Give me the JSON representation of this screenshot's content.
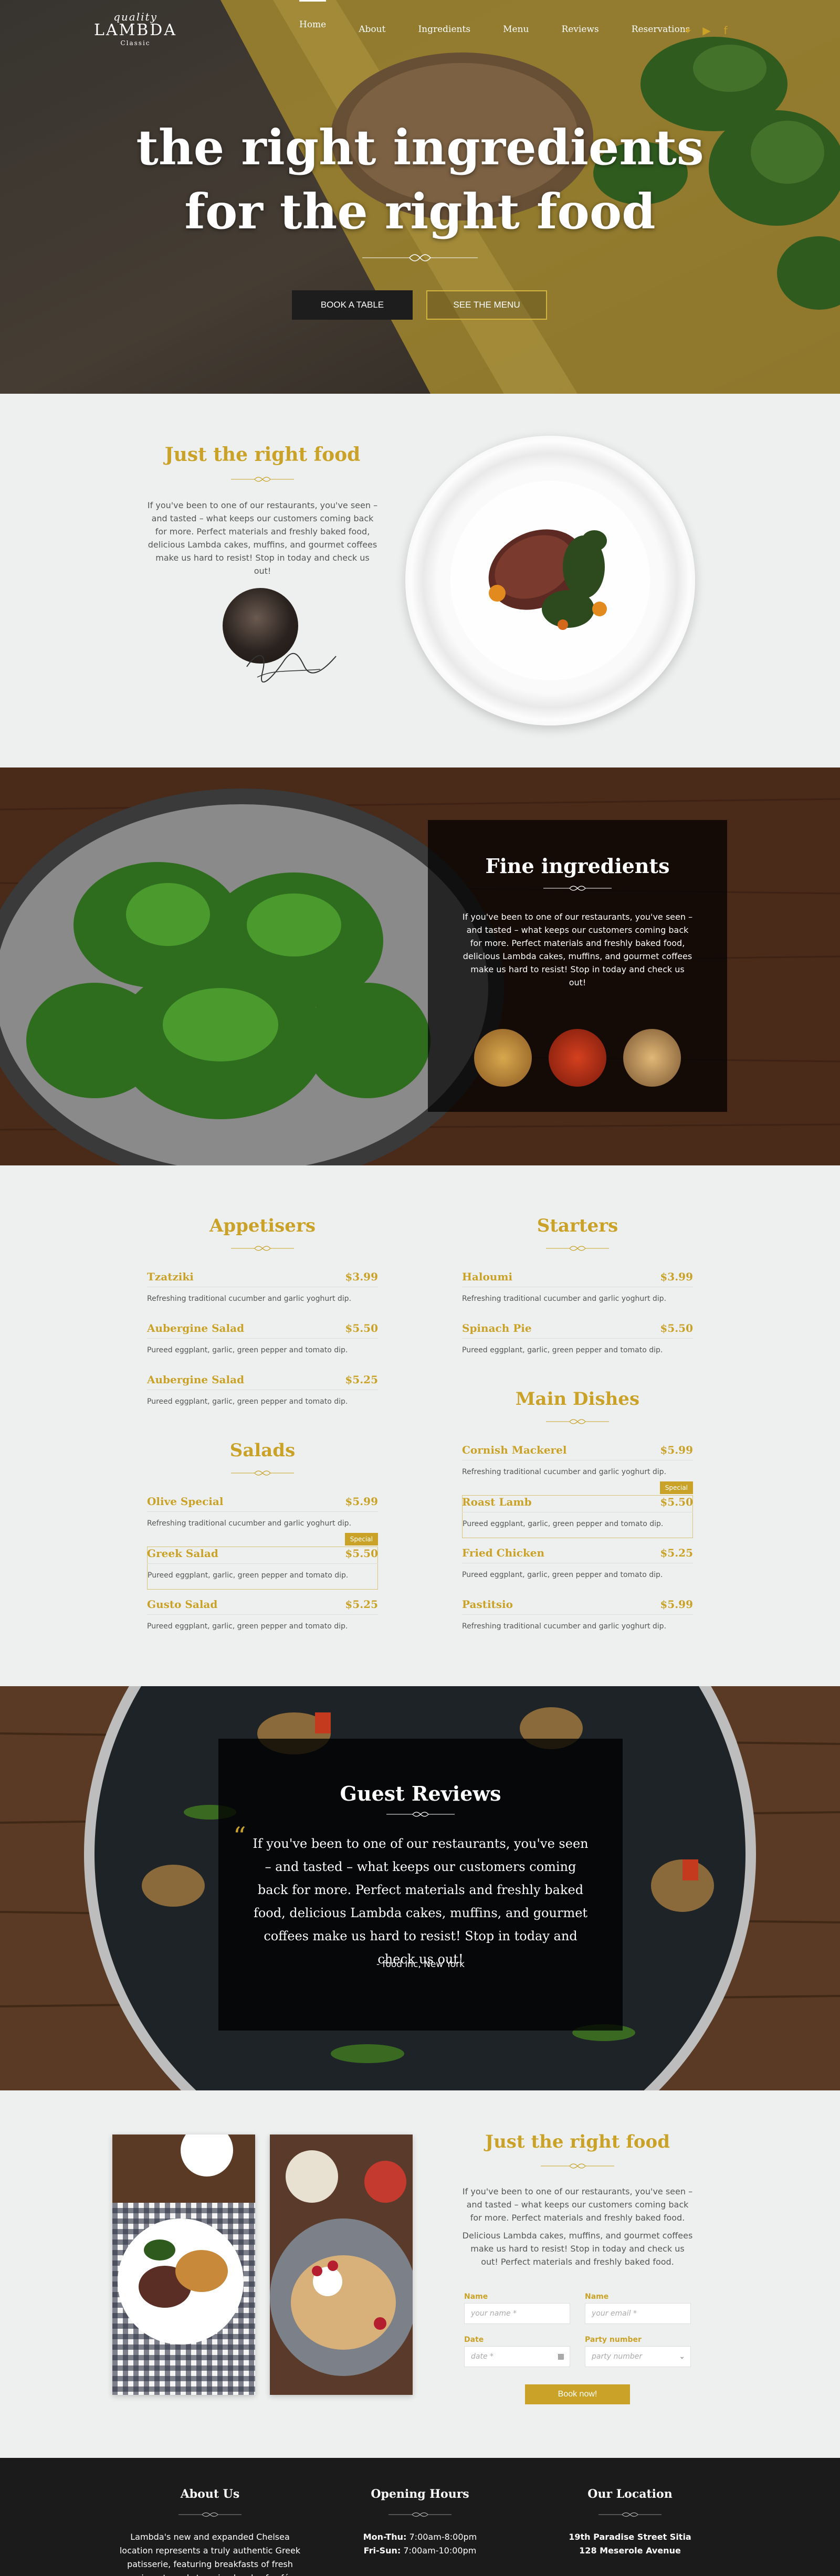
{
  "brand": {
    "top": "quality",
    "name": "LAMBDA",
    "tag": "Classic"
  },
  "nav": [
    "Home",
    "About",
    "Ingredients",
    "Menu",
    "Reviews",
    "Reservations"
  ],
  "social": [
    "twitter-icon",
    "youtube-icon",
    "facebook-icon"
  ],
  "hero": {
    "line1": "the right ingredients",
    "line2": "for the right food",
    "book_btn": "BOOK A TABLE",
    "menu_btn": "SEE THE MENU"
  },
  "intro": {
    "title": "Just the right food",
    "text": "If you've been to one of our restaurants, you've seen – and tasted – what keeps our customers coming back for more. Perfect materials and freshly baked food, delicious Lambda cakes, muffins, and gourmet coffees make us hard to resist! Stop in today and check us out!"
  },
  "fine": {
    "title": "Fine ingredients",
    "text": "If you've been to one of our restaurants, you've seen – and tasted – what keeps our customers coming back for more. Perfect materials and freshly baked food, delicious Lambda cakes, muffins, and gourmet coffees make us hard to resist! Stop in today and check us out!"
  },
  "menu": {
    "appetisers": {
      "title": "Appetisers",
      "items": [
        {
          "name": "Tzatziki",
          "price": "$3.99",
          "desc": "Refreshing traditional cucumber and garlic yoghurt dip."
        },
        {
          "name": "Aubergine Salad",
          "price": "$5.50",
          "desc": "Pureed eggplant, garlic, green pepper and tomato dip."
        },
        {
          "name": "Aubergine Salad",
          "price": "$5.25",
          "desc": "Pureed eggplant, garlic, green pepper and tomato dip."
        }
      ]
    },
    "starters": {
      "title": "Starters",
      "items": [
        {
          "name": "Haloumi",
          "price": "$3.99",
          "desc": "Refreshing traditional cucumber and garlic yoghurt dip."
        },
        {
          "name": "Spinach Pie",
          "price": "$5.50",
          "desc": "Pureed eggplant, garlic, green pepper and tomato dip."
        }
      ]
    },
    "salads": {
      "title": "Salads",
      "items": [
        {
          "name": "Olive Special",
          "price": "$5.99",
          "desc": "Refreshing traditional cucumber and garlic yoghurt dip."
        },
        {
          "name": "Greek Salad",
          "price": "$5.50",
          "desc": "Pureed eggplant, garlic, green pepper and tomato dip.",
          "badge": "Special"
        },
        {
          "name": "Gusto Salad",
          "price": "$5.25",
          "desc": "Pureed eggplant, garlic, green pepper and tomato dip."
        }
      ]
    },
    "mains": {
      "title": "Main Dishes",
      "items": [
        {
          "name": "Cornish Mackerel",
          "price": "$5.99",
          "desc": "Refreshing traditional cucumber and garlic yoghurt dip."
        },
        {
          "name": "Roast Lamb",
          "price": "$5.50",
          "desc": "Pureed eggplant, garlic, green pepper and tomato dip.",
          "badge": "Special"
        },
        {
          "name": "Fried Chicken",
          "price": "$5.25",
          "desc": "Pureed eggplant, garlic, green pepper and tomato dip."
        },
        {
          "name": "Pastitsio",
          "price": "$5.99",
          "desc": "Refreshing traditional cucumber and garlic yoghurt dip."
        }
      ]
    }
  },
  "reviews": {
    "title": "Guest Reviews",
    "quote": "If you've been to one of our restaurants, you've seen – and tasted – what keeps our customers coming back for more. Perfect materials and freshly baked food, delicious Lambda cakes, muffins, and gourmet coffees make us hard to resist! Stop in today and check us out!",
    "author": "- food inc, New York"
  },
  "booking": {
    "title": "Just the right food",
    "text1": "If you've been to one of our restaurants, you've seen – and tasted – what keeps our customers coming back for more. Perfect materials and freshly baked food.",
    "text2": "Delicious Lambda cakes, muffins, and gourmet coffees make us hard to resist! Stop in today and check us out! Perfect materials and freshly baked food.",
    "name_label": "Name",
    "name_ph": "your name *",
    "email_label": "Name",
    "email_ph": "your email *",
    "date_label": "Date",
    "date_ph": "date *",
    "party_label": "Party number",
    "party_ph": "party number",
    "button": "Book now!"
  },
  "footer": {
    "about_title": "About Us",
    "about_text": "Lambda's new and expanded Chelsea location represents a truly authentic Greek patisserie, featuring breakfasts of fresh croissants and steaming bowls of café.",
    "hours_title": "Opening Hours",
    "hours_1_label": "Mon-Thu:",
    "hours_1": "7:00am-8:00pm",
    "hours_2_label": "Fri-Sun:",
    "hours_2": "7:00am-10:00pm",
    "loc_title": "Our Location",
    "loc_1": "19th Paradise Street Sitia",
    "loc_2": "128 Meserole Avenue"
  },
  "colors": {
    "gold": "#c9a227",
    "dark": "#1b1b1b",
    "light": "#eef0f0"
  }
}
